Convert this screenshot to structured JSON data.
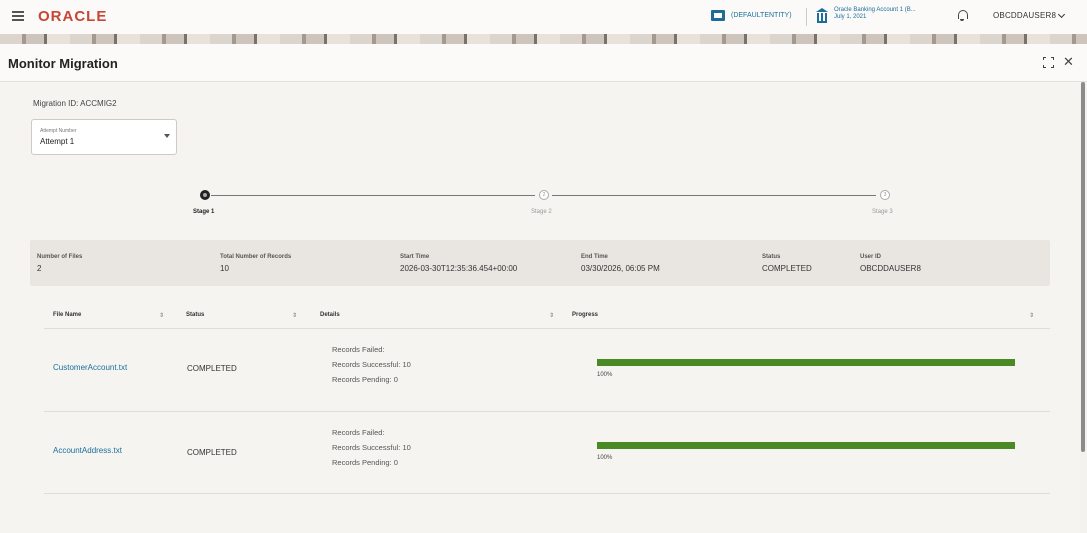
{
  "header": {
    "brand": "ORACLE",
    "entity": "(DEFAULTENTITY)",
    "bank_line1": "Oracle Banking Account 1 (B...",
    "bank_line2": "July 1, 2021",
    "user": "OBCDDAUSER8"
  },
  "page": {
    "title": "Monitor Migration"
  },
  "migration": {
    "id_label": "Migration ID:",
    "id_value": "ACCMIG2",
    "attempt_label": "Attempt Number",
    "attempt_value": "Attempt 1"
  },
  "stepper": {
    "steps": [
      {
        "label": "Stage 1",
        "marker": ""
      },
      {
        "label": "Stage 2",
        "marker": "2"
      },
      {
        "label": "Stage 3",
        "marker": "3"
      }
    ]
  },
  "summary": {
    "items": [
      {
        "label": "Number of Files",
        "value": "2"
      },
      {
        "label": "Total Number of Records",
        "value": "10"
      },
      {
        "label": "Start Time",
        "value": "2026-03-30T12:35:36.454+00:00"
      },
      {
        "label": "End Time",
        "value": "03/30/2026, 06:05 PM"
      },
      {
        "label": "Status",
        "value": "COMPLETED"
      },
      {
        "label": "User ID",
        "value": "OBCDDAUSER8"
      }
    ]
  },
  "table": {
    "headers": [
      "File Name",
      "Status",
      "Details",
      "Progress"
    ],
    "sort_glyph": "⇕",
    "rows": [
      {
        "file": "CustomerAccount.txt",
        "status": "COMPLETED",
        "details": [
          "Records Failed:",
          "Records Successful: 10",
          "Records Pending: 0"
        ],
        "progress": 1.0,
        "progress_label": "100%"
      },
      {
        "file": "AccountAddress.txt",
        "status": "COMPLETED",
        "details": [
          "Records Failed:",
          "Records Successful: 10",
          "Records Pending: 0"
        ],
        "progress": 1.0,
        "progress_label": "100%"
      }
    ]
  },
  "colors": {
    "brand": "#c74634",
    "link": "#1a6f9a",
    "progress": "#4a8a25"
  }
}
